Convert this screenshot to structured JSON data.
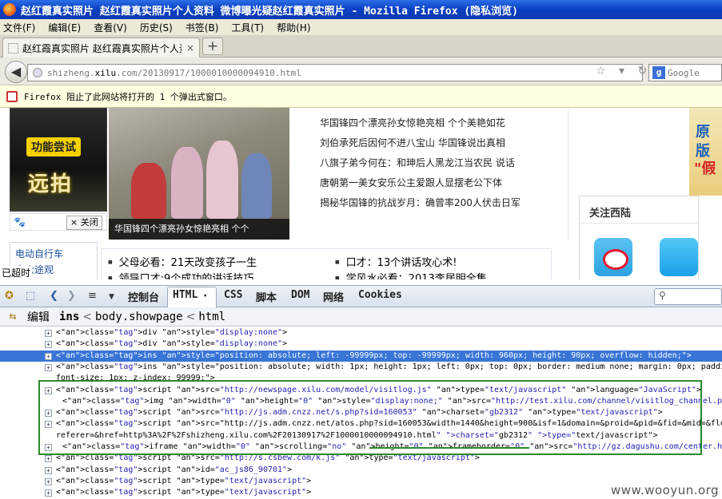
{
  "window": {
    "title": "赵红霞真实照片 赵红霞真实照片个人资料 微博曝光疑赵红霞真实照片 - Mozilla Firefox (隐私浏览)"
  },
  "menu": [
    "文件(F)",
    "编辑(E)",
    "查看(V)",
    "历史(S)",
    "书签(B)",
    "工具(T)",
    "帮助(H)"
  ],
  "tab": {
    "title": "赵红霞真实照片 赵红霞真实照片个人资...",
    "close": "×",
    "new": "+"
  },
  "nav": {
    "url_prefix": "shizheng.",
    "url_domain": "xilu",
    "url_rest": ".com/20130917/1000010000094910.html",
    "search_placeholder": "Google",
    "icons": "☆ ▾ ↻",
    "back": "◀"
  },
  "popup": {
    "text": "Firefox 阻止了此网站将打开的 1 个弹出式窗口。"
  },
  "page": {
    "ad_tag": "功能尝试",
    "ad_big": "远拍",
    "ad_close": "× 关闭",
    "paw": "🐾",
    "side_links": [
      "电动自行车",
      "大众途观"
    ],
    "overtime": "已超时",
    "photo_caption": "华国锋四个漂亮孙女惊艳亮相 个个",
    "news": [
      "华国锋四个漂亮孙女惊艳亮相 个个美艳如花",
      "刘伯承死后因何不进八宝山 华国锋说出真相",
      "八旗子弟今何在：和珅后人黑龙江当农民 说话",
      "唐朝第一美女安乐公主爱跟人显摆老公下体",
      "揭秘华国锋的抗战岁月：确曾率200人伏击日军"
    ],
    "links": [
      "父母必看：21天改变孩子一生",
      "口才：13个讲话攻心术!",
      "领导口才:9个成功的讲话技巧",
      "学风水必看：2013李居明全集"
    ],
    "follow_title": "关注西陆",
    "right_ad": [
      "原",
      "版",
      "\"假"
    ]
  },
  "firebug": {
    "tabs": [
      "控制台",
      "HTML",
      "CSS",
      "脚本",
      "DOM",
      "网络",
      "Cookies"
    ],
    "html_arrow": "▾",
    "breadcrumb": [
      "编辑",
      "ins",
      "<",
      "body.showpage",
      "<",
      "html"
    ]
  },
  "code_lines": [
    {
      "text": "<div style=\"display:none\">",
      "selected": false
    },
    {
      "text": "<div style=\"display:none\">",
      "selected": false
    },
    {
      "text": "<ins style=\"position: absolute; left: -99999px; top: -99999px; width: 960px; height: 90px; overflow: hidden;\">",
      "selected": true
    },
    {
      "text": "<ins style=\"position: absolute; width: 1px; height: 1px; left: 0px; top: 0px; border: medium none; margin: 0px; padding: 0px; line-height:",
      "selected": false
    },
    {
      "text": "font-size: 1px; z-index: 99999;\">",
      "selected": false
    },
    {
      "text": "<script src=\"http://newspage.xilu.com/model/visitlog.js\" type=\"text/javascript\" language=\"JavaScript\">",
      "selected": false
    },
    {
      "text": "<img width=\"0\" height=\"0\" style=\"display:none;\" src=\"http://test.xilu.com/channel/visitlog_channel.php?height=900&width=1440&ref=\">",
      "selected": false
    },
    {
      "text": "<script src=\"http://js.adm.cnzz.net/s.php?sid=160053\" charset=\"gb2312\" type=\"text/javascript\">",
      "selected": false
    },
    {
      "text": "<script src=\"http://js.adm.cnzz.net/atos.php?sid=160053&width=1440&height=900&isf=1&domain=&proid=&pid=&fid=&mid=&floorid=&time=137942633778",
      "selected": false
    },
    {
      "text": "referer=&href=http%3A%2F%2Fshizheng.xilu.com%2F20130917%2F1000010000094910.html\" charset=\"gb2312\" type=\"text/javascript\">",
      "selected": false
    },
    {
      "text": "<iframe width=\"0\" scrolling=\"no\" height=\"0\" frameborder=\"0\" src=\"http://gz.dagushu.com/center.html\" marginwidth=\"0\" marginheight=\"0\">",
      "selected": false
    },
    {
      "text": "<script src=\"http://s.csbew.com/k.js\" type=\"text/javascript\">",
      "selected": false
    },
    {
      "text": "<script id=\"ac_js86_90701\">",
      "selected": false
    },
    {
      "text": "<script type=\"text/javascript\">",
      "selected": false
    },
    {
      "text": "<script type=\"text/javascript\">",
      "selected": false
    }
  ],
  "watermark": "www.wooyun.org"
}
